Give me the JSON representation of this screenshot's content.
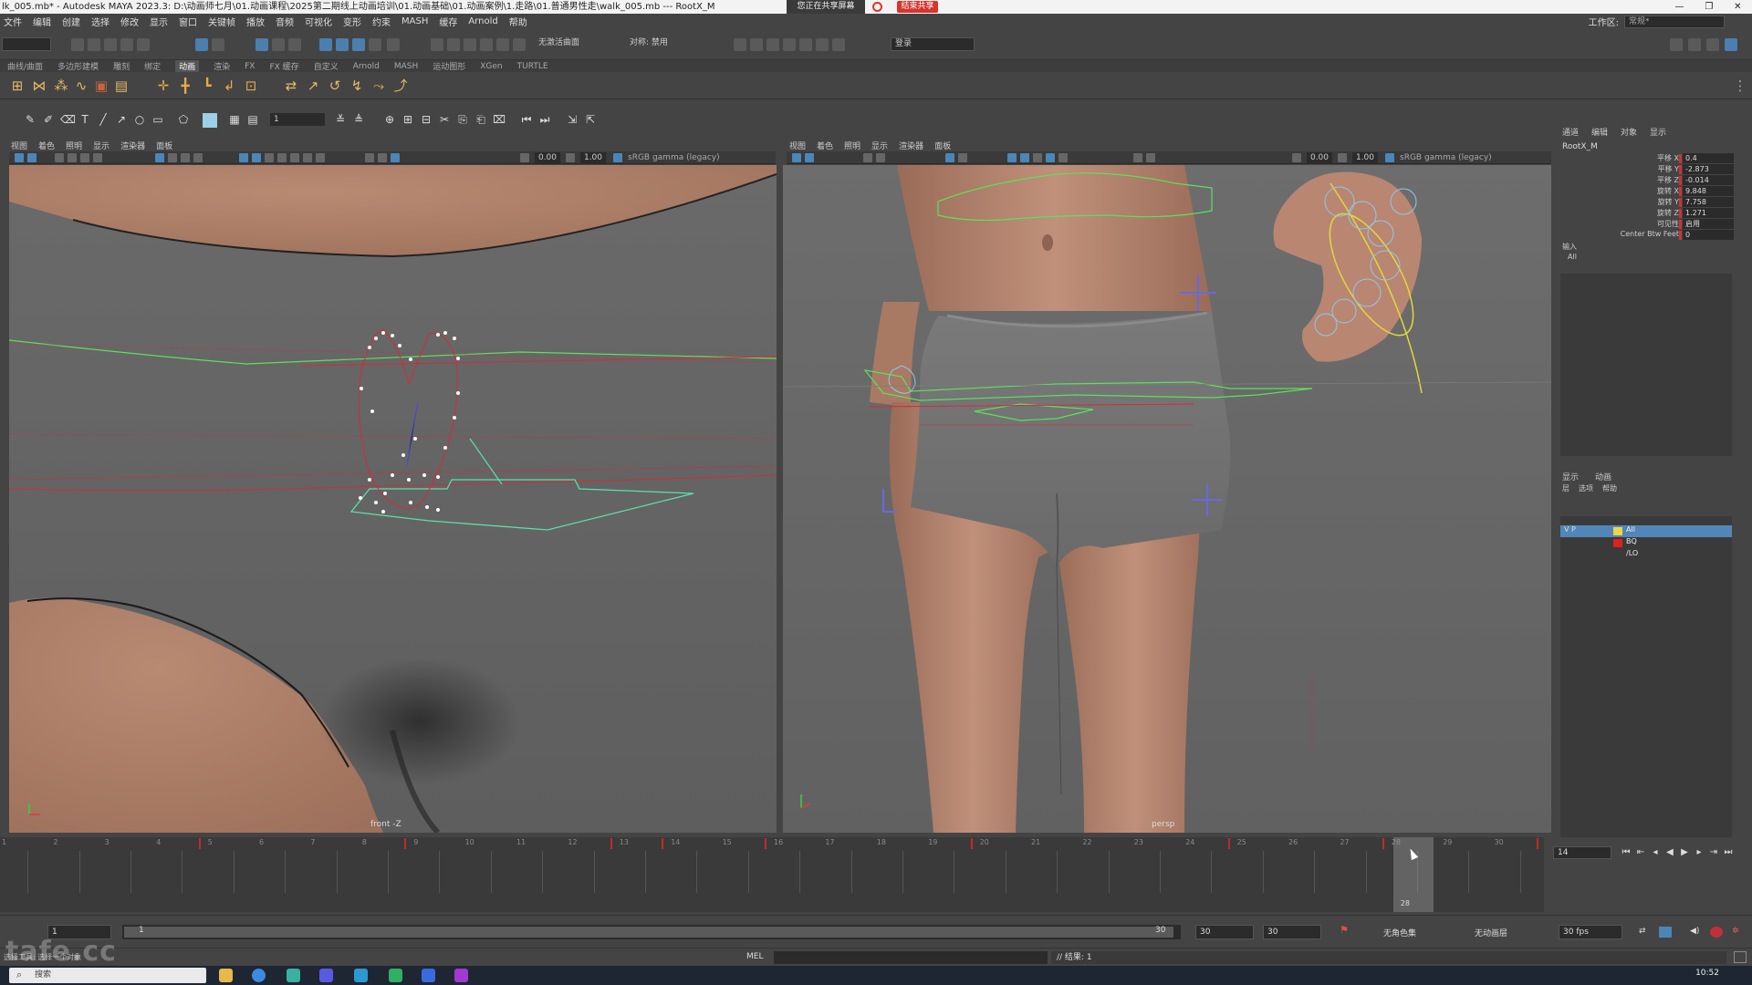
{
  "window": {
    "title": "lk_005.mb* - Autodesk MAYA 2023.3: D:\\动画师七月\\01.动画课程\\2025第二期线上动画培训\\01.动画基础\\01.动画案例\\1.走路\\01.普通男性走\\walk_005.mb   ---   RootX_M",
    "share_text": "您正在共享屏幕",
    "stop_share": "结束共享"
  },
  "menubar": {
    "items": [
      "文件",
      "编辑",
      "创建",
      "选择",
      "修改",
      "显示",
      "窗口",
      "关键帧",
      "播放",
      "音频",
      "可视化",
      "变形",
      "约束",
      "MASH",
      "缓存",
      "Arnold",
      "帮助"
    ],
    "workspace_label": "工作区:",
    "workspace_value": "常规*"
  },
  "statusline": {
    "live_surface": "无激活曲面",
    "symmetry": "对称: 禁用",
    "login": "登录"
  },
  "shelf": {
    "tabs": [
      "曲线/曲面",
      "多边形建模",
      "雕刻",
      "绑定",
      "动画",
      "渲染",
      "FX",
      "FX 缓存",
      "自定义",
      "Arnold",
      "MASH",
      "运动图形",
      "XGen",
      "TURTLE"
    ],
    "active_tab": "动画",
    "toolbar_frame_value": "1"
  },
  "viewport_left": {
    "menu": [
      "视图",
      "着色",
      "照明",
      "显示",
      "渲染器",
      "面板"
    ],
    "exposure": "0.00",
    "gamma": "1.00",
    "colorspace": "sRGB gamma (legacy)",
    "camera_label": "front -Z"
  },
  "viewport_right": {
    "menu": [
      "视图",
      "着色",
      "照明",
      "显示",
      "渲染器",
      "面板"
    ],
    "exposure": "0.00",
    "gamma": "1.00",
    "colorspace": "sRGB gamma (legacy)",
    "camera_label": "persp"
  },
  "channel_box": {
    "tabs": [
      "通道",
      "编辑",
      "对象",
      "显示"
    ],
    "node": "RootX_M",
    "attributes": [
      {
        "label": "平移 X",
        "value": "0.4"
      },
      {
        "label": "平移 Y",
        "value": "-2.873"
      },
      {
        "label": "平移 Z",
        "value": "-0.014"
      },
      {
        "label": "旋转 X",
        "value": "9.848"
      },
      {
        "label": "旋转 Y",
        "value": "7.758"
      },
      {
        "label": "旋转 Z",
        "value": "1.271"
      },
      {
        "label": "可见性",
        "value": "启用"
      },
      {
        "label": "Center Btw Feet",
        "value": "0"
      }
    ],
    "inputs_label": "输入",
    "inputs_all": "All",
    "display_tabs": [
      "显示",
      "动画"
    ],
    "display_menu": [
      "层",
      "选项",
      "帮助"
    ],
    "layers": [
      {
        "flags": "V  P",
        "name": "All",
        "color": "#e8d84a",
        "selected": true
      },
      {
        "flags": "",
        "name": "BQ",
        "color": "#e02020",
        "selected": false
      },
      {
        "flags": "",
        "name": "/LO",
        "color": "",
        "selected": false
      }
    ]
  },
  "timeline": {
    "frames": [
      "1",
      "2",
      "3",
      "4",
      "5",
      "6",
      "7",
      "8",
      "9",
      "10",
      "11",
      "12",
      "13",
      "14",
      "15",
      "16",
      "17",
      "18",
      "19",
      "20",
      "21",
      "22",
      "23",
      "24",
      "25",
      "26",
      "27",
      "28",
      "29",
      "30"
    ],
    "keys": [
      4,
      8,
      12,
      13,
      15,
      19,
      24,
      27,
      30
    ],
    "current_frame": "28",
    "frame_field": "14"
  },
  "range": {
    "start": "1",
    "inner_start": "1",
    "inner_end": "30",
    "end": "30",
    "end2": "30",
    "character_set": "无角色集",
    "anim_layer": "无动画层",
    "fps": "30 fps"
  },
  "command": {
    "language": "MEL",
    "result": "// 结果: 1",
    "help": "选择工具: 选择一个对象"
  },
  "taskbar": {
    "search": "搜索",
    "time": "10:52"
  },
  "watermark": "tafe.cc"
}
